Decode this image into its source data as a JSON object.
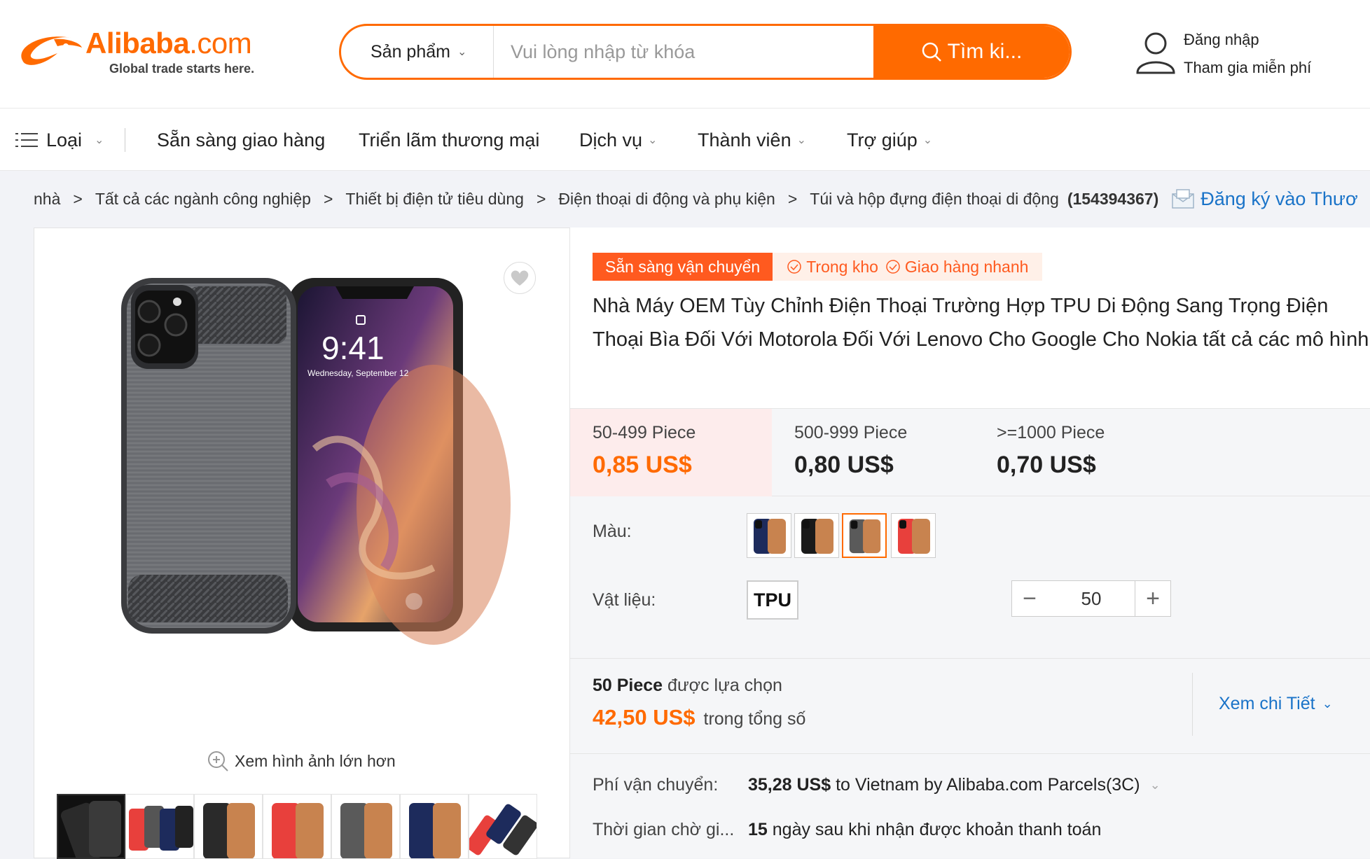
{
  "header": {
    "logo_text": "Alibaba",
    "logo_suffix": ".com",
    "logo_tagline": "Global trade starts here.",
    "search_category": "Sản phẩm",
    "search_placeholder": "Vui lòng nhập từ khóa",
    "search_button": "Tìm ki...",
    "login": "Đăng nhập",
    "join": "Tham gia miễn phí"
  },
  "nav": {
    "categories": "Loại",
    "items": [
      "Sẵn sàng giao hàng",
      "Triển lãm thương mại",
      "Dịch vụ",
      "Thành viên",
      "Trợ giúp"
    ]
  },
  "breadcrumb": {
    "items": [
      "nhà",
      "Tất cả các ngành công nghiệp",
      "Thiết bị điện tử tiêu dùng",
      "Điện thoại di động và phụ kiện",
      "Túi và hộp đựng điện thoại di động"
    ],
    "separator": ">",
    "count": "(154394367)",
    "subscribe": "Đăng ký vào Thươ"
  },
  "gallery": {
    "zoom_label": "Xem hình ảnh lớn hơn",
    "thumbnail_count": 7
  },
  "product": {
    "badge_ready": "Sẵn sàng vận chuyển",
    "badge_stock": "Trong kho",
    "badge_fast": "Giao hàng nhanh",
    "title": "Nhà Máy OEM Tùy Chỉnh Điện Thoại Trường Hợp TPU Di Động Sang Trọng Điện Thoại Bìa Đối Với Motorola Đối Với Lenovo Cho Google Cho Nokia tất cả các mô hình",
    "tiers": [
      {
        "qty": "50-499 Piece",
        "price": "0,85 US$"
      },
      {
        "qty": "500-999 Piece",
        "price": "0,80 US$"
      },
      {
        "qty": ">=1000 Piece",
        "price": "0,70 US$"
      }
    ],
    "color_label": "Màu:",
    "colors": [
      "#1d2b5c",
      "#1a1a1a",
      "#5a5a5a",
      "#e8403c"
    ],
    "selected_color_index": 2,
    "material_label": "Vật liệu:",
    "material": "TPU",
    "quantity": "50",
    "minus": "−",
    "plus": "+",
    "summary_qty": "50 Piece",
    "summary_selected": "được lựa chọn",
    "summary_total": "42,50 US$",
    "summary_total_label": "trong tổng số",
    "detail_link": "Xem chi Tiết",
    "shipping_label": "Phí vận chuyển:",
    "shipping_price": "35,28 US$",
    "shipping_text": "to Vietnam by Alibaba.com Parcels(3C)",
    "lead_label": "Thời gian chờ gi...",
    "lead_days": "15",
    "lead_text": "ngày sau khi nhận được khoản thanh toán"
  }
}
